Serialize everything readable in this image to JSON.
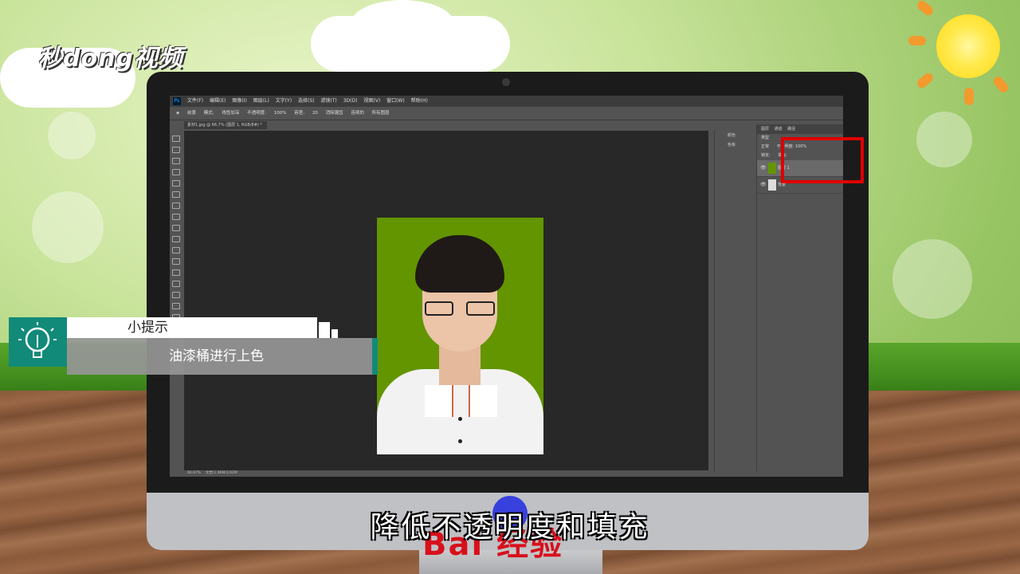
{
  "logo": {
    "text": "秒dong视频"
  },
  "photoshop": {
    "app_icon": "Ps",
    "menu": [
      "文件(F)",
      "编辑(E)",
      "图像(I)",
      "图层(L)",
      "文字(Y)",
      "选择(S)",
      "滤镜(T)",
      "3D(D)",
      "视图(V)",
      "窗口(W)",
      "帮助(H)"
    ],
    "options_bar": {
      "tool_preset": "前景",
      "mode_label": "模式:",
      "mode_value": "线性加深",
      "opacity_label": "不透明度:",
      "opacity_value": "100%",
      "tolerance_label": "容差:",
      "tolerance_value": "20",
      "antialias": "消除锯齿",
      "contiguous": "连续的",
      "all_layers": "所有图层"
    },
    "document_tab": "素材1.jpg @ 66.7% (图层 1, RGB/8#) *",
    "status_bar": {
      "zoom": "66.67%",
      "doc_info": "文档:1.96M/3.92M"
    },
    "mid_panel": {
      "color": "颜色",
      "swatches": "色板"
    },
    "layers_panel": {
      "tabs": [
        "图层",
        "通道",
        "路径"
      ],
      "filter": "类型",
      "blend_mode": "正常",
      "opacity_label": "不透明度:",
      "opacity_value": "100%",
      "lock_label": "锁定:",
      "fill_label": "填充:",
      "layers": [
        {
          "name": "图层 1"
        },
        {
          "name": "背景"
        }
      ]
    }
  },
  "tip": {
    "title": "小提示",
    "body": "油漆桶进行上色",
    "icon": "lightbulb-icon"
  },
  "watermark": {
    "text": "Bai 经验"
  },
  "subtitle": "降低不透明度和填充",
  "colors": {
    "photo_bg": "#639500",
    "tip_accent": "#128a79",
    "highlight": "#e00000"
  }
}
